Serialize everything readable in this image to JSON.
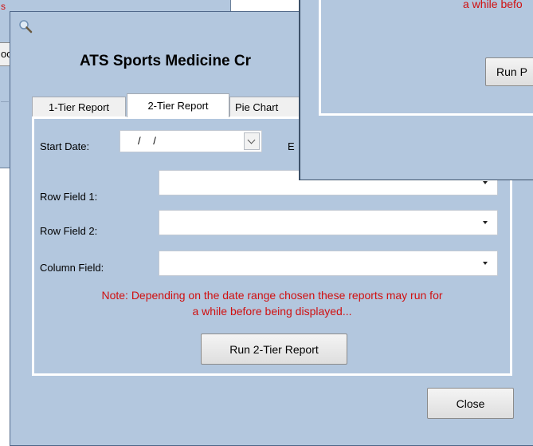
{
  "app": {
    "title": "ATS Sports Medicine Cr"
  },
  "tabs": [
    {
      "label": "1-Tier Report"
    },
    {
      "label": "2-Tier Report"
    },
    {
      "label": "Pie Chart"
    }
  ],
  "form": {
    "start_date_label": "Start Date:",
    "start_date_value": "/ /",
    "end_date_label_partial": "E",
    "row_field_1_label": "Row Field 1:",
    "row_field_2_label": "Row Field 2:",
    "column_field_label": "Column Field:",
    "note_line1": "Note:  Depending on the date range chosen these reports may run for",
    "note_line2": "a while before being displayed...",
    "run_button": "Run 2-Tier Report"
  },
  "footer": {
    "close_button": "Close"
  },
  "bg_window_right": {
    "note_partial": "a while befo",
    "run_button_partial": "Run P"
  },
  "bg_window_left": {
    "text_partial_1": "s",
    "text_partial_2": "oc"
  },
  "colors": {
    "window_bg": "#b3c7de",
    "note_text": "#d01010",
    "tab_bg": "#f0f0f0"
  }
}
